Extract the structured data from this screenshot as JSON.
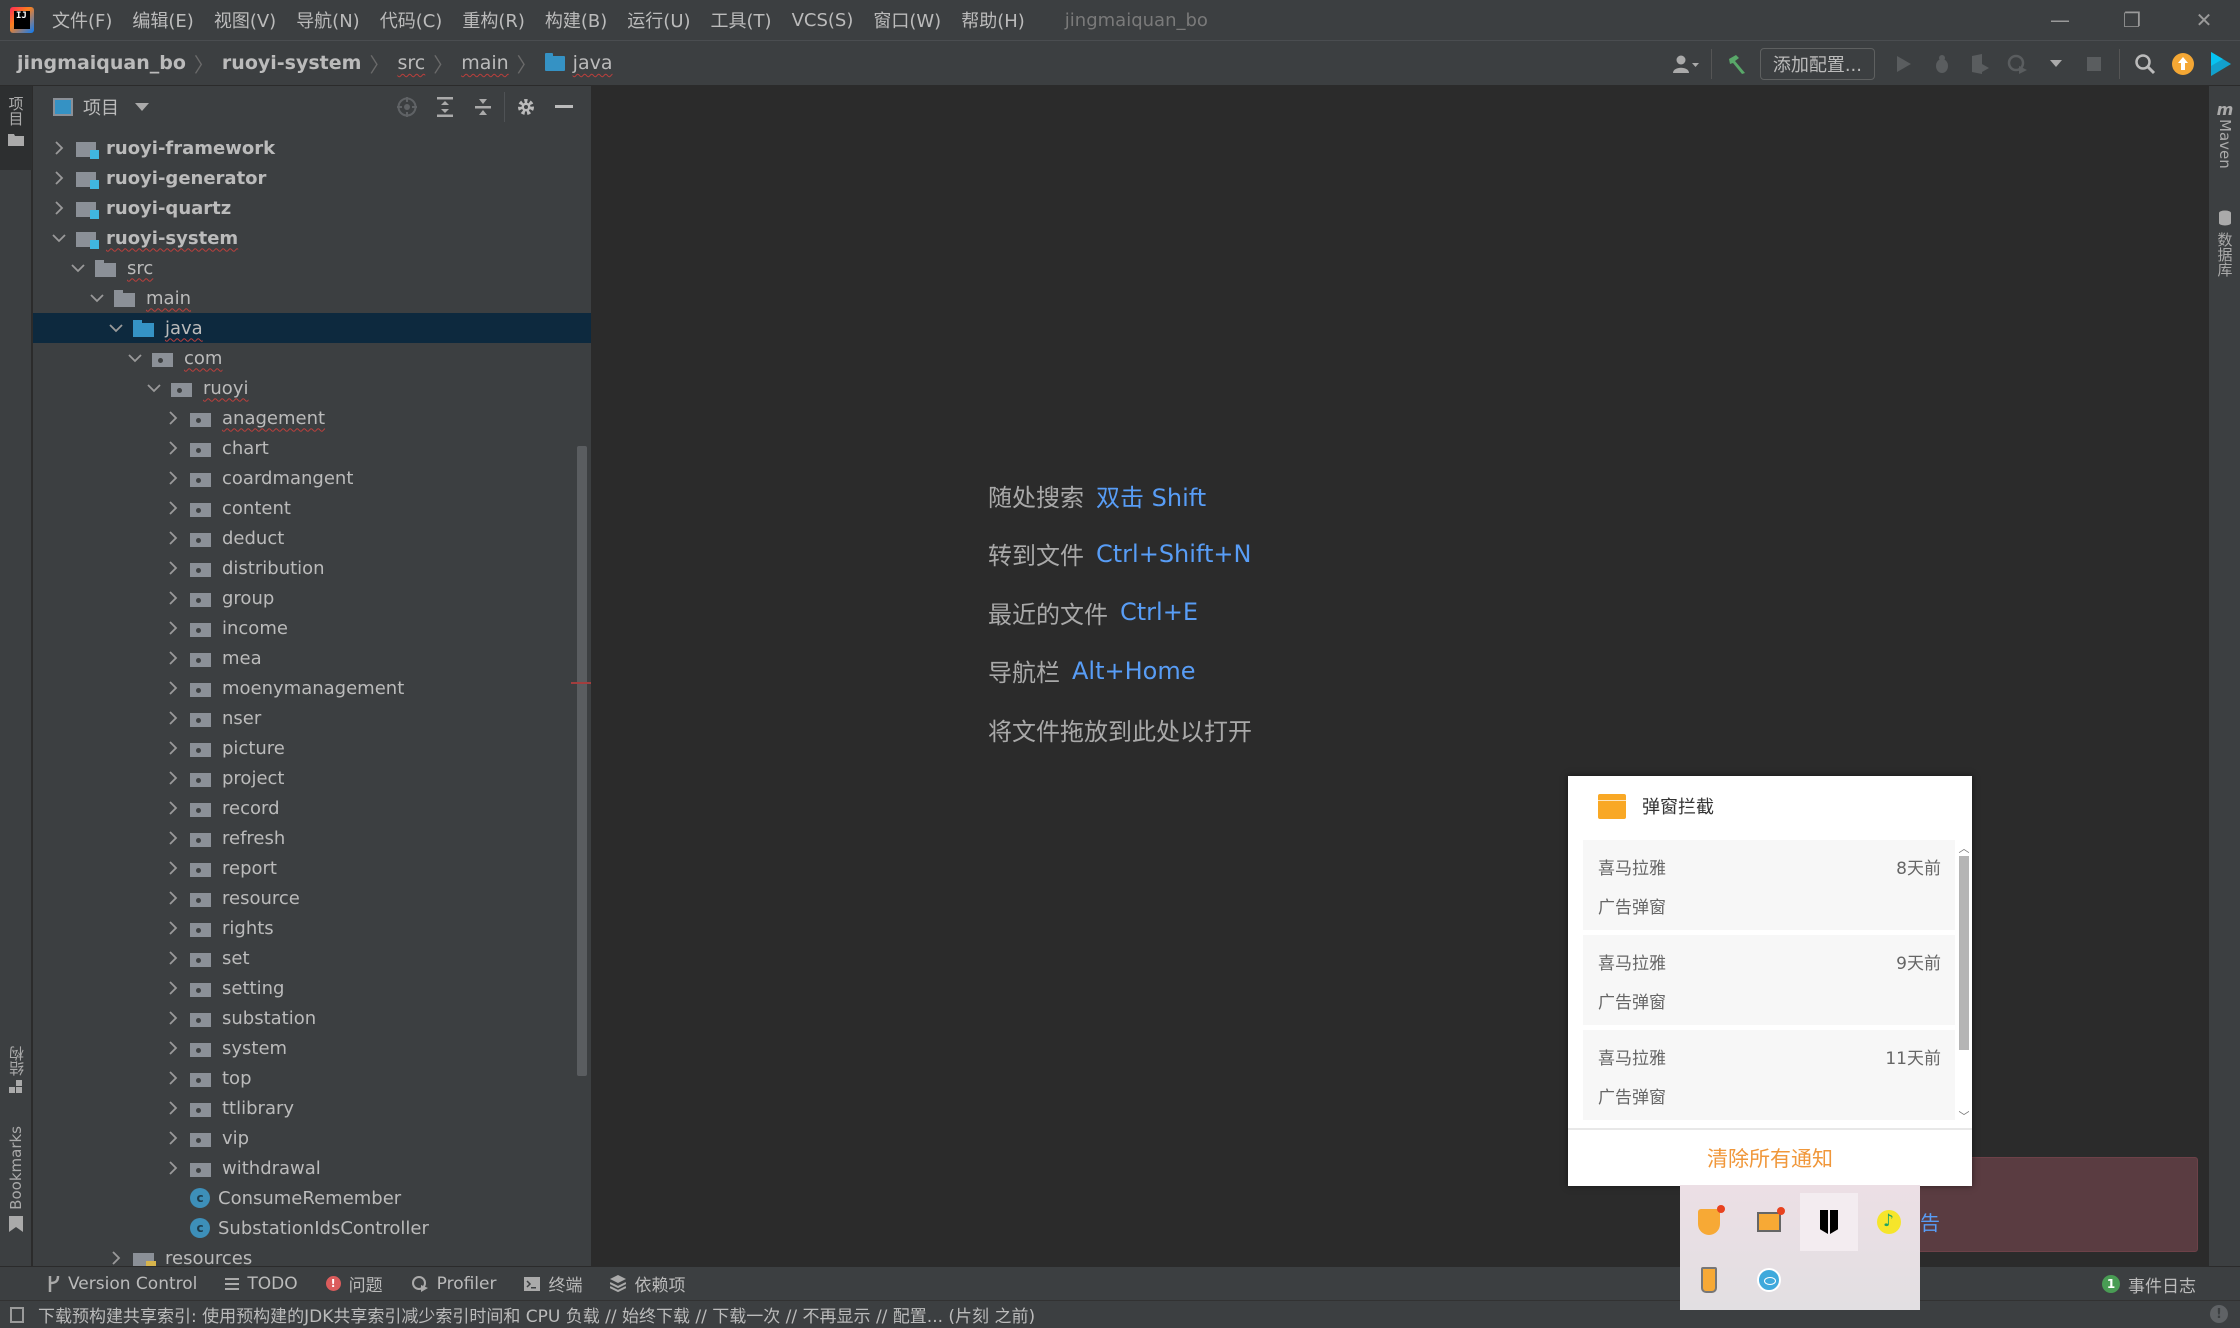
{
  "titlebar": {
    "menu": [
      "文件(F)",
      "编辑(E)",
      "视图(V)",
      "导航(N)",
      "代码(C)",
      "重构(R)",
      "构建(B)",
      "运行(U)",
      "工具(T)",
      "VCS(S)",
      "窗口(W)",
      "帮助(H)"
    ],
    "window_title": "jingmaiquan_bo",
    "logo_text": "IJ",
    "controls": {
      "minimize": "—",
      "restore": "❐",
      "close": "✕"
    }
  },
  "navbar": {
    "breadcrumbs": [
      "jingmaiquan_bo",
      "ruoyi-system",
      "src",
      "main",
      "java"
    ],
    "separator": "〉",
    "add_config_label": "添加配置...",
    "icons": [
      "user-icon",
      "build-hammer-icon",
      "run-icon",
      "debug-icon",
      "coverage-icon",
      "profile-icon",
      "stop-icon",
      "search-icon",
      "update-icon",
      "toolbox-icon"
    ]
  },
  "left_stripe": {
    "project_tab": "项目",
    "structure_tab": "结构",
    "bookmarks_tab": "Bookmarks"
  },
  "right_stripe": {
    "maven_tab": "Maven",
    "database_tab": "数据库"
  },
  "project_panel": {
    "title": "项目",
    "tree": [
      {
        "label": "ruoyi-framework",
        "type": "module",
        "depth": 1,
        "expanded": false,
        "bold": true
      },
      {
        "label": "ruoyi-generator",
        "type": "module",
        "depth": 1,
        "expanded": false,
        "bold": true
      },
      {
        "label": "ruoyi-quartz",
        "type": "module",
        "depth": 1,
        "expanded": false,
        "bold": true
      },
      {
        "label": "ruoyi-system",
        "type": "module",
        "depth": 1,
        "expanded": true,
        "bold": true,
        "squiggle": true
      },
      {
        "label": "src",
        "type": "folder",
        "depth": 2,
        "expanded": true,
        "squiggle": true
      },
      {
        "label": "main",
        "type": "folder",
        "depth": 3,
        "expanded": true,
        "squiggle": true
      },
      {
        "label": "java",
        "type": "source-folder",
        "depth": 4,
        "expanded": true,
        "squiggle": true,
        "selected": true
      },
      {
        "label": "com",
        "type": "package",
        "depth": 5,
        "expanded": true,
        "squiggle": true
      },
      {
        "label": "ruoyi",
        "type": "package",
        "depth": 6,
        "expanded": true,
        "squiggle": true
      },
      {
        "label": "anagement",
        "type": "package",
        "depth": 7,
        "expanded": false,
        "squiggle": true
      },
      {
        "label": "chart",
        "type": "package",
        "depth": 7,
        "expanded": false
      },
      {
        "label": "coardmangent",
        "type": "package",
        "depth": 7,
        "expanded": false
      },
      {
        "label": "content",
        "type": "package",
        "depth": 7,
        "expanded": false
      },
      {
        "label": "deduct",
        "type": "package",
        "depth": 7,
        "expanded": false
      },
      {
        "label": "distribution",
        "type": "package",
        "depth": 7,
        "expanded": false
      },
      {
        "label": "group",
        "type": "package",
        "depth": 7,
        "expanded": false
      },
      {
        "label": "income",
        "type": "package",
        "depth": 7,
        "expanded": false
      },
      {
        "label": "mea",
        "type": "package",
        "depth": 7,
        "expanded": false
      },
      {
        "label": "moenymanagement",
        "type": "package",
        "depth": 7,
        "expanded": false
      },
      {
        "label": "nser",
        "type": "package",
        "depth": 7,
        "expanded": false
      },
      {
        "label": "picture",
        "type": "package",
        "depth": 7,
        "expanded": false
      },
      {
        "label": "project",
        "type": "package",
        "depth": 7,
        "expanded": false
      },
      {
        "label": "record",
        "type": "package",
        "depth": 7,
        "expanded": false
      },
      {
        "label": "refresh",
        "type": "package",
        "depth": 7,
        "expanded": false
      },
      {
        "label": "report",
        "type": "package",
        "depth": 7,
        "expanded": false
      },
      {
        "label": "resource",
        "type": "package",
        "depth": 7,
        "expanded": false
      },
      {
        "label": "rights",
        "type": "package",
        "depth": 7,
        "expanded": false
      },
      {
        "label": "set",
        "type": "package",
        "depth": 7,
        "expanded": false
      },
      {
        "label": "setting",
        "type": "package",
        "depth": 7,
        "expanded": false
      },
      {
        "label": "substation",
        "type": "package",
        "depth": 7,
        "expanded": false
      },
      {
        "label": "system",
        "type": "package",
        "depth": 7,
        "expanded": false
      },
      {
        "label": "top",
        "type": "package",
        "depth": 7,
        "expanded": false
      },
      {
        "label": "ttlibrary",
        "type": "package",
        "depth": 7,
        "expanded": false
      },
      {
        "label": "vip",
        "type": "package",
        "depth": 7,
        "expanded": false
      },
      {
        "label": "withdrawal",
        "type": "package",
        "depth": 7,
        "expanded": false
      },
      {
        "label": "ConsumeRemember",
        "type": "class",
        "depth": 7
      },
      {
        "label": "SubstationIdsController",
        "type": "class",
        "depth": 7
      },
      {
        "label": "resources",
        "type": "resources-folder",
        "depth": 4,
        "expanded": false
      }
    ]
  },
  "editor": {
    "hints": [
      {
        "label": "随处搜索",
        "shortcut": "双击 Shift"
      },
      {
        "label": "转到文件",
        "shortcut": "Ctrl+Shift+N"
      },
      {
        "label": "最近的文件",
        "shortcut": "Ctrl+E"
      },
      {
        "label": "导航栏",
        "shortcut": "Alt+Home"
      },
      {
        "label": "将文件拖放到此处以打开",
        "shortcut": ""
      }
    ]
  },
  "background_notification": {
    "partial_text": "告"
  },
  "popup": {
    "title": "弹窗拦截",
    "items": [
      {
        "app": "喜马拉雅",
        "time": "8天前",
        "desc": "广告弹窗"
      },
      {
        "app": "喜马拉雅",
        "time": "9天前",
        "desc": "广告弹窗"
      },
      {
        "app": "喜马拉雅",
        "time": "11天前",
        "desc": "广告弹窗"
      }
    ],
    "clear_all_label": "清除所有通知",
    "scroll_position": 0.0,
    "accent_color": "#f0973a"
  },
  "tray": {
    "icons": [
      "security-shield-icon",
      "popup-blocker-icon",
      "bookmark-app-icon",
      "qq-music-icon",
      "usb-drive-icon",
      "eye-care-icon"
    ]
  },
  "bottom_toolbar": {
    "buttons": [
      {
        "label": "Version Control",
        "icon": "ᚹ"
      },
      {
        "label": "TODO",
        "icon": "☰"
      },
      {
        "label": "问题",
        "icon": "!"
      },
      {
        "label": "Profiler",
        "icon": "◔"
      },
      {
        "label": "终端",
        "icon": "▣"
      },
      {
        "label": "依赖项",
        "icon": "◈"
      }
    ],
    "event_log_label": "事件日志",
    "event_log_count": "1"
  },
  "statusbar": {
    "message": "下载预构建共享索引: 使用预构建的JDK共享索引减少索引时间和 CPU 负载 // 始终下载 // 下载一次 // 不再显示 // 配置... (片刻 之前)"
  }
}
